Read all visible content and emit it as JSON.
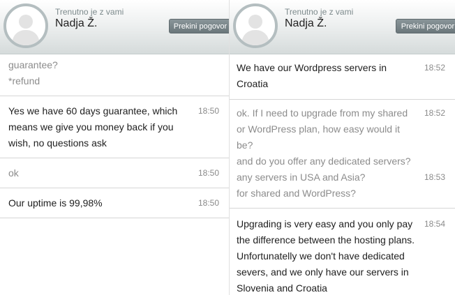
{
  "left": {
    "header": {
      "status": "Trenutno je z vami",
      "agent_name": "Nadja Ž.",
      "end_button": "Prekini pogovor"
    },
    "messages": [
      {
        "sender": "visitor",
        "lines": [
          "guarantee?",
          "*refund"
        ],
        "time": ""
      },
      {
        "sender": "agent",
        "lines": [
          "Yes we have 60 days guarantee, which",
          "means we give you money back if you",
          "wish, no questions ask"
        ],
        "time": "18:50"
      },
      {
        "sender": "visitor",
        "lines": [
          "ok"
        ],
        "time": "18:50"
      },
      {
        "sender": "agent",
        "lines": [
          "Our uptime is 99,98%"
        ],
        "time": "18:50"
      }
    ]
  },
  "right": {
    "header": {
      "status": "Trenutno je z vami",
      "agent_name": "Nadja Ž.",
      "end_button": "Prekini pogovor"
    },
    "messages": [
      {
        "sender": "agent",
        "lines": [
          "We have our Wordpress servers in",
          "Croatia"
        ],
        "time": "18:52"
      },
      {
        "sender": "visitor",
        "lines": [
          "ok. If I need to upgrade from my shared",
          "or WordPress plan, how easy would it",
          "be?",
          "and do you offer any dedicated servers?",
          "any servers in USA and Asia?",
          "for shared and WordPress?"
        ],
        "times": [
          "18:52",
          "",
          "",
          "",
          "18:53",
          ""
        ]
      },
      {
        "sender": "agent",
        "lines": [
          "Upgrading is very easy and you only pay",
          "the difference between the hosting plans.",
          "Unfortunatelly we don't have dedicated",
          "severs, and we only have our servers in",
          "Slovenia and Croatia"
        ],
        "time": "18:54"
      }
    ]
  }
}
